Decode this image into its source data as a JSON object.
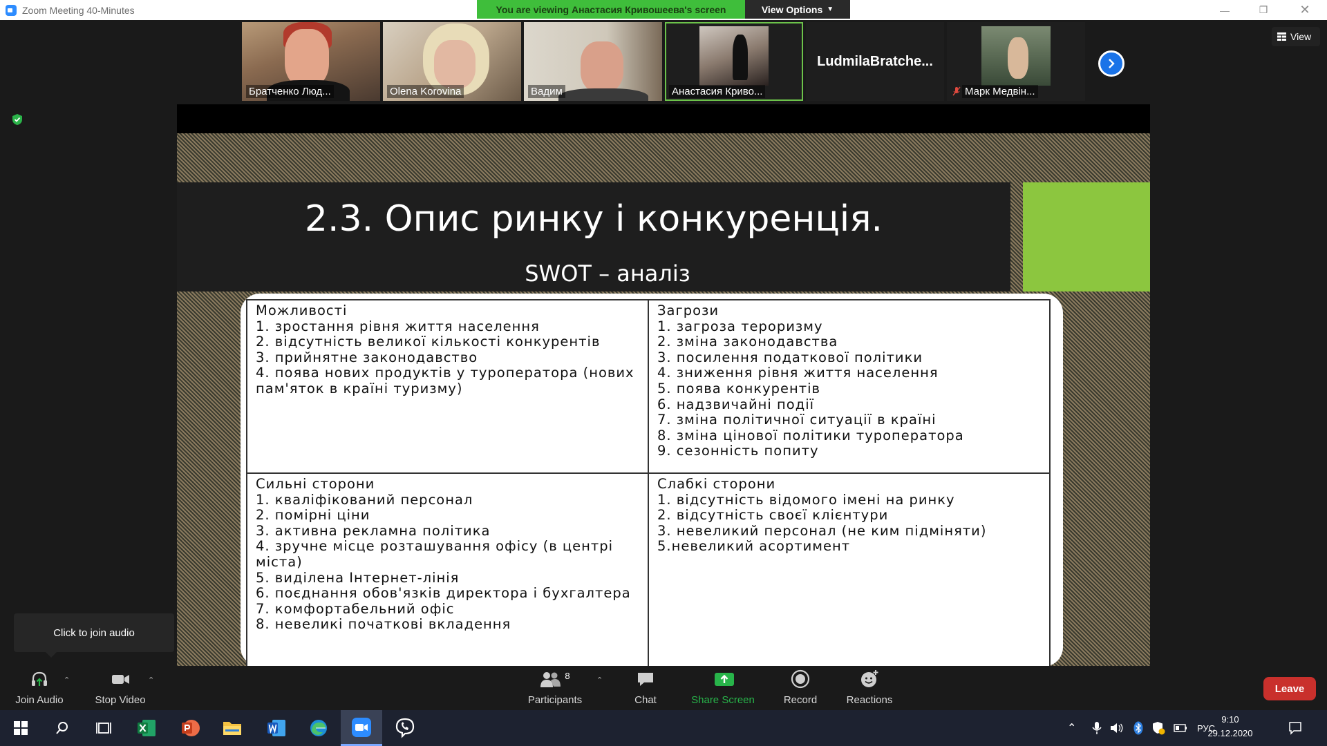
{
  "window": {
    "title": "Zoom Meeting 40-Minutes",
    "banner_text": "You are viewing Анастасия Кривошеева's screen",
    "view_options_label": "View Options",
    "view_label": "View"
  },
  "participants_strip": [
    {
      "name": "Братченко Люд..."
    },
    {
      "name": "Olena Korovina"
    },
    {
      "name": "Вадим"
    },
    {
      "name": "Анастасия Криво..."
    },
    {
      "name": "LudmilaBratche..."
    },
    {
      "name": "Марк Медвін..."
    }
  ],
  "slide": {
    "title": "2.3. Опис ринку і конкуренція.",
    "subtitle": "SWOT – аналіз",
    "quadrants": {
      "opportunities": [
        "Можливості",
        "1. зростання рівня життя населення",
        "2. відсутність великої кількості конкурентів",
        "3. прийнятне законодавство",
        "4. поява нових продуктів у туроператора (нових пам'яток в країні туризму)"
      ],
      "threats": [
        "Загрози",
        "1. загроза тероризму",
        "2. зміна законодавства",
        "3. посилення податкової політики",
        "4. зниження рівня життя населення",
        "5. поява конкурентів",
        "6. надзвичайні події",
        "7. зміна політичної ситуації в країні",
        "8. зміна цінової політики туроператора",
        "9. сезонність попиту"
      ],
      "strengths": [
        "Сильні сторони",
        "1. кваліфікований персонал",
        "2. помірні ціни",
        "3. активна рекламна політика",
        "4. зручне місце розташування офісу (в центрі міста)",
        "5. виділена Інтернет-лінія",
        "6. поєднання обов'язків директора і бухгалтера",
        "7. комфортабельний офіс",
        "8. невеликі початкові вкладення"
      ],
      "weaknesses": [
        "Слабкі сторони",
        "1. відсутність відомого імені на ринку",
        "2. відсутність своєї клієнтури",
        "3. невеликий персонал (не ким підміняти)",
        "5.невеликий асортимент"
      ]
    }
  },
  "tooltip": {
    "text": "Click to join audio"
  },
  "toolbar": {
    "join_audio": "Join Audio",
    "stop_video": "Stop Video",
    "participants": "Participants",
    "participants_count": "8",
    "chat": "Chat",
    "share_screen": "Share Screen",
    "record": "Record",
    "reactions": "Reactions",
    "leave": "Leave"
  },
  "taskbar": {
    "language": "РУС",
    "time": "9:10",
    "date": "29.12.2020"
  },
  "colors": {
    "banner_green": "#3fbe3b",
    "slide_accent_green": "#8cc63f",
    "leave_red": "#c9302c",
    "share_green": "#28b44a",
    "next_blue": "#1a73e8"
  }
}
